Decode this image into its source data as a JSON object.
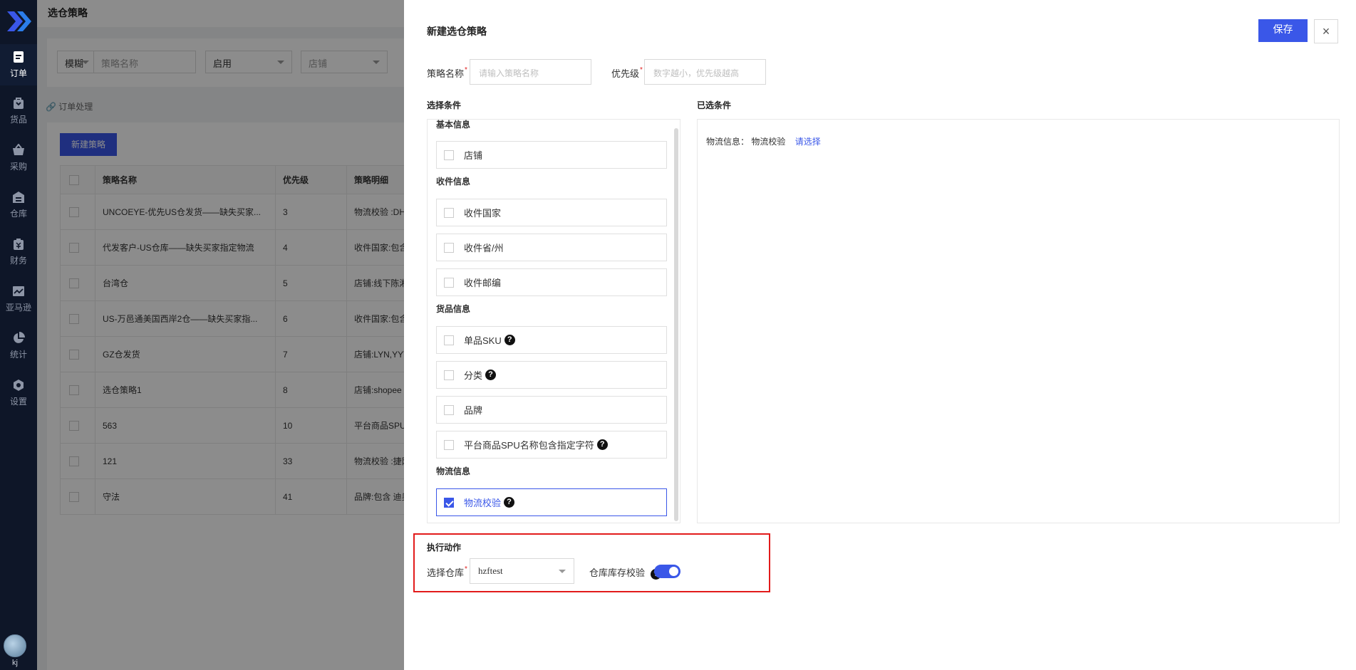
{
  "nav": {
    "items": [
      {
        "label": "订单",
        "icon": "order-icon"
      },
      {
        "label": "货品",
        "icon": "goods-icon"
      },
      {
        "label": "采购",
        "icon": "purchase-icon"
      },
      {
        "label": "仓库",
        "icon": "warehouse-icon"
      },
      {
        "label": "财务",
        "icon": "finance-icon"
      },
      {
        "label": "亚马逊",
        "icon": "amazon-chart-icon"
      },
      {
        "label": "统计",
        "icon": "pie-chart-icon"
      },
      {
        "label": "设置",
        "icon": "settings-icon"
      }
    ],
    "user": "kj"
  },
  "background": {
    "page_title": "选仓策略",
    "filter": {
      "mode": "模糊",
      "name_placeholder": "策略名称",
      "status": "启用",
      "shop_placeholder": "店铺"
    },
    "breadcrumb": "订单处理",
    "new_button": "新建策略",
    "table": {
      "headers": [
        "策略名称",
        "优先级",
        "策略明细"
      ],
      "rows": [
        [
          "UNCOEYE-优先US仓发货——缺失买家...",
          "3",
          "物流校验 :DHL"
        ],
        [
          "代发客户-US仓库——缺失买家指定物流",
          "4",
          "收件国家:包含"
        ],
        [
          "台湾仓",
          "5",
          "店铺:线下陈湘"
        ],
        [
          "US-万邑通美国西岸2仓——缺失买家指...",
          "6",
          "收件国家:包含"
        ],
        [
          "GZ仓发货",
          "7",
          "店铺:LYN,YYT"
        ],
        [
          "选仓策略1",
          "8",
          "店铺:shopee"
        ],
        [
          "563",
          "10",
          "平台商品SPU"
        ],
        [
          "121",
          "33",
          "物流校验 :捷网"
        ],
        [
          "守法",
          "41",
          "品牌:包含 迪奥"
        ]
      ]
    }
  },
  "drawer": {
    "title": "新建选仓策略",
    "save": "保存",
    "close": "×",
    "name_label": "策略名称",
    "name_placeholder": "请输入策略名称",
    "priority_label": "优先级",
    "priority_placeholder": "数字越小，优先级越高",
    "conditions_title": "选择条件",
    "selected_title": "已选条件",
    "groups": {
      "basic": "基本信息",
      "recipient": "收件信息",
      "goods": "货品信息",
      "logistics": "物流信息"
    },
    "items": {
      "shop": "店铺",
      "country": "收件国家",
      "province": "收件省/州",
      "zip": "收件邮编",
      "sku": "单品SKU",
      "category": "分类",
      "brand": "品牌",
      "spu_name": "平台商品SPU名称包含指定字符",
      "logistics_check": "物流校验"
    },
    "selected": {
      "label": "物流信息：",
      "value": "物流校验",
      "link": "请选择"
    },
    "action": {
      "title": "执行动作",
      "warehouse_label": "选择仓库",
      "warehouse_value": "hzftest",
      "stock_check_label": "仓库库存校验",
      "stock_check_on": true
    },
    "accent": "#3a57e8",
    "highlight": "#e21b1b"
  }
}
